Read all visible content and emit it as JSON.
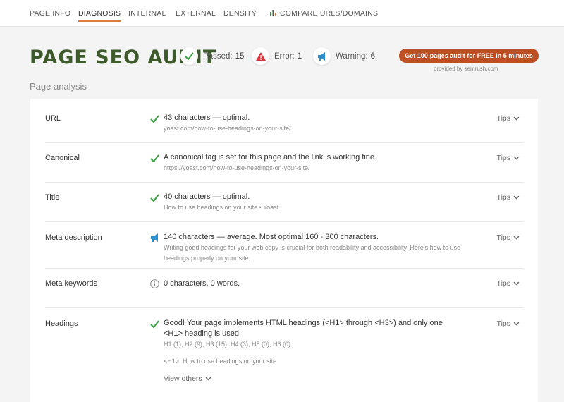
{
  "nav": {
    "page_info": "PAGE INFO",
    "diagnosis": "DIAGNOSIS",
    "internal": "INTERNAL",
    "external": "EXTERNAL",
    "density": "DENSITY",
    "compare": "COMPARE URLS/DOMAINS",
    "active": "diagnosis"
  },
  "header": {
    "title": "PAGE SEO AUDIT",
    "passed_label": "Passed:",
    "passed_count": "15",
    "error_label": "Error:",
    "error_count": "1",
    "warning_label": "Warning:",
    "warning_count": "6",
    "cta": "Get 100-pages audit for FREE in 5 minutes",
    "provided_by": "provided by  semrush.com",
    "section": "Page analysis"
  },
  "colors": {
    "title_green": "#3d5a2a",
    "check_green": "#3aa142",
    "error_red": "#d9343a",
    "warning_blue": "#2a8fcf",
    "cta_bg": "#bd4f25",
    "active_underline": "#e07a3f"
  },
  "tips_label": "Tips",
  "rows": [
    {
      "label": "URL",
      "status": "check-icon",
      "main": "43 characters — optimal.",
      "sub": "yoast.com/how-to-use-headings-on-your-site/"
    },
    {
      "label": "Canonical",
      "status": "check-icon",
      "main": "A canonical tag is set for this page and the link is working fine.",
      "sub": "https://yoast.com/how-to-use-headings-on-your-site/"
    },
    {
      "label": "Title",
      "status": "check-icon",
      "main": "40 characters — optimal.",
      "sub": "How to use headings on your site • Yoast"
    },
    {
      "label": "Meta description",
      "status": "megaphone-icon",
      "main": "140 characters — average. Most optimal 160 - 300 characters.",
      "sub": "Writing good headings for your web copy is crucial for both readability and accessibility. Here's how to use headings properly on your site."
    },
    {
      "label": "Meta keywords",
      "status": "info-icon",
      "main": "0 characters, 0 words.",
      "sub": ""
    },
    {
      "label": "Headings",
      "status": "check-icon",
      "main": "Good! Your page implements HTML headings (<H1> through <H3>) and only one <H1> heading is used.",
      "sub": "H1 (1), H2 (9), H3 (15), H4 (3), H5 (0), H6 (0)",
      "sub2": "<H1>: How to use headings on your site",
      "more": "View others"
    }
  ]
}
